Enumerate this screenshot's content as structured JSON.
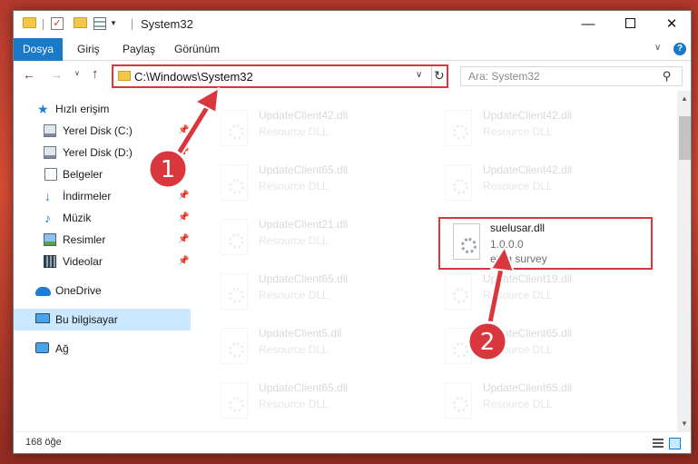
{
  "window": {
    "title": "System32",
    "controls": {
      "minimize": "—",
      "maximize": "",
      "close": "✕"
    }
  },
  "ribbon": {
    "tabs": [
      {
        "label": "Dosya",
        "active": true
      },
      {
        "label": "Giriş"
      },
      {
        "label": "Paylaş"
      },
      {
        "label": "Görünüm"
      }
    ]
  },
  "address_bar": {
    "path": "C:\\Windows\\System32"
  },
  "search": {
    "placeholder": "Ara: System32"
  },
  "sidebar": {
    "items": [
      {
        "label": "Hızlı erişim",
        "icon": "star-icon"
      },
      {
        "label": "Yerel Disk (C:)",
        "icon": "disk-icon",
        "pinned": true
      },
      {
        "label": "Yerel Disk (D:)",
        "icon": "disk-icon",
        "pinned": true
      },
      {
        "label": "Belgeler",
        "icon": "documents-icon"
      },
      {
        "label": "İndirmeler",
        "icon": "download-icon",
        "pinned": true
      },
      {
        "label": "Müzik",
        "icon": "music-icon",
        "pinned": true
      },
      {
        "label": "Resimler",
        "icon": "pictures-icon",
        "pinned": true
      },
      {
        "label": "Videolar",
        "icon": "videos-icon",
        "pinned": true
      },
      {
        "label": "OneDrive",
        "icon": "cloud-icon"
      },
      {
        "label": "Bu bilgisayar",
        "icon": "computer-icon",
        "selected": true
      },
      {
        "label": "Ağ",
        "icon": "network-icon"
      }
    ]
  },
  "files": [
    {
      "name": "UpdateClient42.dll",
      "type": "Resource DLL"
    },
    {
      "name": "UpdateClient42.dll",
      "type": "Resource DLL"
    },
    {
      "name": "UpdateClient65.dll",
      "type": "Resource DLL"
    },
    {
      "name": "UpdateClient42.dll",
      "type": "Resource DLL"
    },
    {
      "name": "UpdateClient21.dll",
      "type": "Resource DLL"
    },
    {
      "name": "suelusar.dll",
      "type": "1.0.0.0",
      "company": "ereg survey",
      "highlighted": true
    },
    {
      "name": "UpdateClient65.dll",
      "type": "Resource DLL"
    },
    {
      "name": "UpdateClient19.dll",
      "type": "Resource DLL"
    },
    {
      "name": "UpdateClient5.dll",
      "type": "Resource DLL"
    },
    {
      "name": "UpdateClient65.dll",
      "type": "Resource DLL"
    },
    {
      "name": "UpdateClient65.dll",
      "type": "Resource DLL"
    },
    {
      "name": "UpdateClient65.dll",
      "type": "Resource DLL"
    }
  ],
  "status": {
    "item_count": "168 öğe"
  },
  "annotations": {
    "step1": "1",
    "step2": "2",
    "color": "#d9363e"
  }
}
